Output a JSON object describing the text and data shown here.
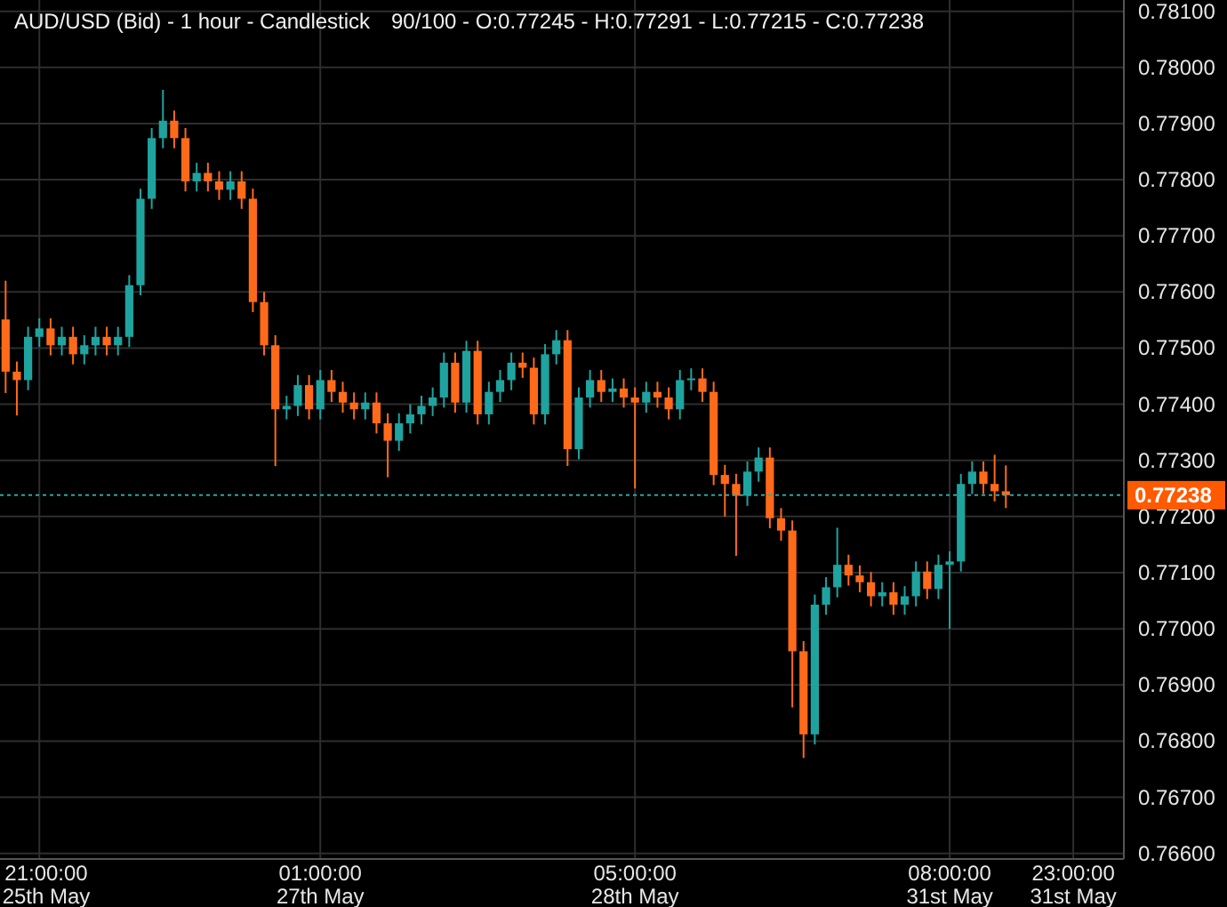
{
  "legend": "90/100 - O:0.77245 - H:0.77291 - L:0.77215 - C:0.77238",
  "chart_data": {
    "type": "candlestick",
    "grid": true,
    "title": "AUD/USD (Bid) - 1 hour - Candlestick",
    "categories": [
      null,
      null,
      null,
      "21:00:00\n25th May",
      null,
      null,
      null,
      null,
      null,
      null,
      null,
      null,
      null,
      null,
      null,
      null,
      null,
      null,
      null,
      null,
      null,
      null,
      null,
      null,
      null,
      null,
      null,
      null,
      "01:00:00\n27th May",
      null,
      null,
      null,
      null,
      null,
      null,
      null,
      null,
      null,
      null,
      null,
      null,
      null,
      null,
      null,
      null,
      null,
      null,
      null,
      null,
      null,
      null,
      null,
      null,
      null,
      null,
      null,
      "05:00:00\n28th May",
      null,
      null,
      null,
      null,
      null,
      null,
      null,
      null,
      null,
      null,
      null,
      null,
      null,
      null,
      null,
      null,
      null,
      null,
      null,
      null,
      null,
      null,
      null,
      null,
      null,
      null,
      null,
      "08:00:00\n31st May",
      null,
      null,
      null,
      null,
      null,
      null,
      null,
      null,
      null,
      null,
      "23:00:00\n31st May",
      null,
      null,
      null,
      null
    ],
    "ylim": [
      0.7659,
      0.7812
    ],
    "ohlc": [
      [
        0.77551,
        0.7762,
        0.7742,
        0.77458
      ],
      [
        0.77458,
        0.77476,
        0.7738,
        0.77443
      ],
      [
        0.77443,
        0.77538,
        0.77425,
        0.7752
      ],
      [
        0.7752,
        0.77553,
        0.77502,
        0.77535
      ],
      [
        0.77535,
        0.77553,
        0.77487,
        0.77505
      ],
      [
        0.77505,
        0.77538,
        0.77487,
        0.7752
      ],
      [
        0.7752,
        0.77538,
        0.77471,
        0.77489
      ],
      [
        0.77489,
        0.77523,
        0.77471,
        0.77505
      ],
      [
        0.77505,
        0.77538,
        0.77487,
        0.7752
      ],
      [
        0.7752,
        0.77538,
        0.77487,
        0.77505
      ],
      [
        0.77505,
        0.77538,
        0.77487,
        0.7752
      ],
      [
        0.7752,
        0.7763,
        0.77502,
        0.77612
      ],
      [
        0.77612,
        0.77784,
        0.77594,
        0.77766
      ],
      [
        0.77766,
        0.77892,
        0.77748,
        0.77874
      ],
      [
        0.77874,
        0.7796,
        0.77856,
        0.77905
      ],
      [
        0.77905,
        0.77923,
        0.77856,
        0.77874
      ],
      [
        0.77874,
        0.77892,
        0.77779,
        0.77797
      ],
      [
        0.77797,
        0.7783,
        0.77779,
        0.77812
      ],
      [
        0.77812,
        0.7783,
        0.77779,
        0.77797
      ],
      [
        0.77797,
        0.77815,
        0.77764,
        0.77782
      ],
      [
        0.77782,
        0.77815,
        0.77764,
        0.77797
      ],
      [
        0.77797,
        0.77815,
        0.77748,
        0.77766
      ],
      [
        0.77766,
        0.77784,
        0.77564,
        0.77582
      ],
      [
        0.77582,
        0.776,
        0.77487,
        0.77505
      ],
      [
        0.77505,
        0.77523,
        0.7729,
        0.77391
      ],
      [
        0.77391,
        0.77415,
        0.77373,
        0.77397
      ],
      [
        0.77397,
        0.77452,
        0.77379,
        0.77434
      ],
      [
        0.77434,
        0.77452,
        0.77373,
        0.77391
      ],
      [
        0.77391,
        0.77461,
        0.77373,
        0.77443
      ],
      [
        0.77443,
        0.77461,
        0.77404,
        0.77422
      ],
      [
        0.77422,
        0.7744,
        0.77385,
        0.77403
      ],
      [
        0.77403,
        0.77421,
        0.77373,
        0.77391
      ],
      [
        0.77391,
        0.77421,
        0.77373,
        0.77403
      ],
      [
        0.77403,
        0.77421,
        0.77348,
        0.77366
      ],
      [
        0.77366,
        0.77384,
        0.7727,
        0.77335
      ],
      [
        0.77335,
        0.77384,
        0.77317,
        0.77366
      ],
      [
        0.77366,
        0.774,
        0.77348,
        0.77382
      ],
      [
        0.77382,
        0.77415,
        0.77364,
        0.77397
      ],
      [
        0.77397,
        0.7743,
        0.77379,
        0.77412
      ],
      [
        0.77412,
        0.77492,
        0.77394,
        0.77474
      ],
      [
        0.77474,
        0.77492,
        0.77385,
        0.77403
      ],
      [
        0.77403,
        0.77513,
        0.77385,
        0.77495
      ],
      [
        0.77495,
        0.77513,
        0.77364,
        0.77382
      ],
      [
        0.77382,
        0.7744,
        0.77364,
        0.77422
      ],
      [
        0.77422,
        0.77461,
        0.77404,
        0.77443
      ],
      [
        0.77443,
        0.77492,
        0.77425,
        0.77474
      ],
      [
        0.77474,
        0.77492,
        0.77447,
        0.77465
      ],
      [
        0.77465,
        0.77483,
        0.77364,
        0.77382
      ],
      [
        0.77382,
        0.77507,
        0.77364,
        0.77489
      ],
      [
        0.77489,
        0.77532,
        0.77471,
        0.77514
      ],
      [
        0.77514,
        0.77532,
        0.7729,
        0.7732
      ],
      [
        0.7732,
        0.7743,
        0.77302,
        0.77412
      ],
      [
        0.77412,
        0.77461,
        0.77394,
        0.77443
      ],
      [
        0.77443,
        0.77461,
        0.77404,
        0.77422
      ],
      [
        0.77422,
        0.77446,
        0.77404,
        0.77428
      ],
      [
        0.77428,
        0.77446,
        0.77394,
        0.77412
      ],
      [
        0.77412,
        0.7743,
        0.7725,
        0.77403
      ],
      [
        0.77403,
        0.7744,
        0.77385,
        0.77422
      ],
      [
        0.77422,
        0.7744,
        0.77394,
        0.77412
      ],
      [
        0.77412,
        0.7743,
        0.77373,
        0.77391
      ],
      [
        0.77391,
        0.77461,
        0.77373,
        0.77443
      ],
      [
        0.77443,
        0.77464,
        0.77425,
        0.77446
      ],
      [
        0.77446,
        0.77464,
        0.77404,
        0.77422
      ],
      [
        0.77422,
        0.7744,
        0.77256,
        0.77274
      ],
      [
        0.77274,
        0.77292,
        0.772,
        0.77258
      ],
      [
        0.77258,
        0.77276,
        0.7713,
        0.77237
      ],
      [
        0.77237,
        0.77298,
        0.77219,
        0.7728
      ],
      [
        0.7728,
        0.77323,
        0.77262,
        0.77305
      ],
      [
        0.77305,
        0.77323,
        0.77179,
        0.77197
      ],
      [
        0.77197,
        0.77215,
        0.77157,
        0.77175
      ],
      [
        0.77175,
        0.77193,
        0.7686,
        0.7696
      ],
      [
        0.7696,
        0.76978,
        0.7677,
        0.76812
      ],
      [
        0.76812,
        0.77061,
        0.76794,
        0.77043
      ],
      [
        0.77043,
        0.77092,
        0.77025,
        0.77074
      ],
      [
        0.77074,
        0.7718,
        0.77056,
        0.77114
      ],
      [
        0.77114,
        0.77132,
        0.77077,
        0.77095
      ],
      [
        0.77095,
        0.77113,
        0.77065,
        0.77083
      ],
      [
        0.77083,
        0.77101,
        0.7704,
        0.77058
      ],
      [
        0.77058,
        0.77083,
        0.7704,
        0.77065
      ],
      [
        0.77065,
        0.77083,
        0.77025,
        0.77043
      ],
      [
        0.77043,
        0.77076,
        0.77025,
        0.77058
      ],
      [
        0.77058,
        0.7712,
        0.7704,
        0.77102
      ],
      [
        0.77102,
        0.7712,
        0.77053,
        0.77071
      ],
      [
        0.77071,
        0.77132,
        0.77053,
        0.77114
      ],
      [
        0.77114,
        0.77138,
        0.77,
        0.7712
      ],
      [
        0.7712,
        0.77276,
        0.77102,
        0.77258
      ],
      [
        0.77258,
        0.77298,
        0.7724,
        0.7728
      ],
      [
        0.7728,
        0.77298,
        0.7724,
        0.77258
      ],
      [
        0.77258,
        0.7731,
        0.77227,
        0.77245
      ],
      [
        0.77245,
        0.77291,
        0.77215,
        0.77238
      ],
      null,
      null,
      null,
      null,
      null,
      null,
      null,
      null,
      null,
      null
    ],
    "yticks": [
      {
        "value": 0.766,
        "label": "0.76600"
      },
      {
        "value": 0.767,
        "label": "0.76700"
      },
      {
        "value": 0.768,
        "label": "0.76800"
      },
      {
        "value": 0.769,
        "label": "0.76900"
      },
      {
        "value": 0.77,
        "label": "0.77000"
      },
      {
        "value": 0.771,
        "label": "0.77100"
      },
      {
        "value": 0.772,
        "label": "0.77200"
      },
      {
        "value": 0.773,
        "label": "0.77300"
      },
      {
        "value": 0.774,
        "label": "0.77400"
      },
      {
        "value": 0.775,
        "label": "0.77500"
      },
      {
        "value": 0.776,
        "label": "0.77600"
      },
      {
        "value": 0.777,
        "label": "0.77700"
      },
      {
        "value": 0.778,
        "label": "0.77800"
      },
      {
        "value": 0.779,
        "label": "0.77900"
      },
      {
        "value": 0.78,
        "label": "0.78000"
      },
      {
        "value": 0.781,
        "label": "0.78100"
      }
    ],
    "ref_lines": [
      {
        "axis": "y",
        "value": 0.77238,
        "label": "0.77238",
        "color": "#2aa6a6"
      }
    ]
  }
}
